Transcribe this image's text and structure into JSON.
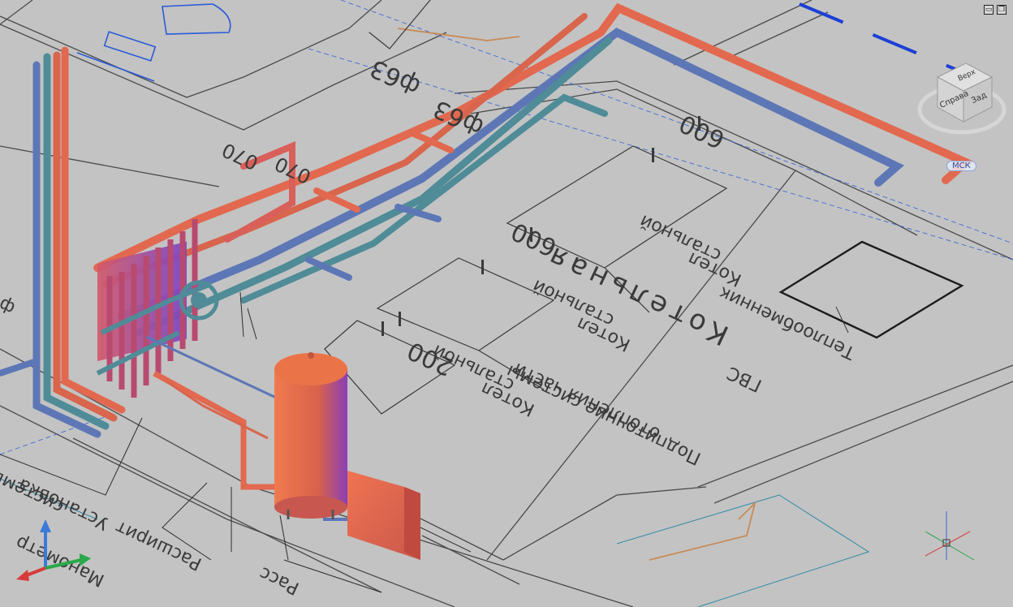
{
  "window_controls": {
    "minimize": "▭",
    "restore": "❐"
  },
  "viewcube": {
    "top": "Верх",
    "front": "Справа",
    "side": "Зад",
    "wcs": "МСК"
  },
  "labels": {
    "boiler_room": "Котельная",
    "boiler_1": "Котел",
    "boiler_1b": "стальной",
    "boiler_2": "Котел",
    "boiler_2b": "стальной",
    "boiler_3": "Котел",
    "boiler_3b": "стальной",
    "heat_exchanger": "Теплообменник",
    "gvs": "ГВС",
    "makeup_1": "Подпиточние системы",
    "makeup_2": "отопления части",
    "left_1": "Установка",
    "left_2": "системы",
    "left_3": "Расширит",
    "left_4": "Манометр",
    "bottom_1": "Расс"
  },
  "dimensions": {
    "d1": "600",
    "d2": "600",
    "d3": "200",
    "d4": "ф63",
    "d5": "ф63",
    "d6": "070",
    "d7": "070",
    "d8": "ф"
  },
  "colors": {
    "background": "#c3c3c3",
    "hot_pipe": "#e2694f",
    "cold_pipe": "#5d77b6",
    "return_pipe": "#4f8c98",
    "tank": "#e56a47",
    "line_dark": "#2d2d2d",
    "line_blue": "#1b3fd6",
    "line_orange": "#c98a55"
  }
}
